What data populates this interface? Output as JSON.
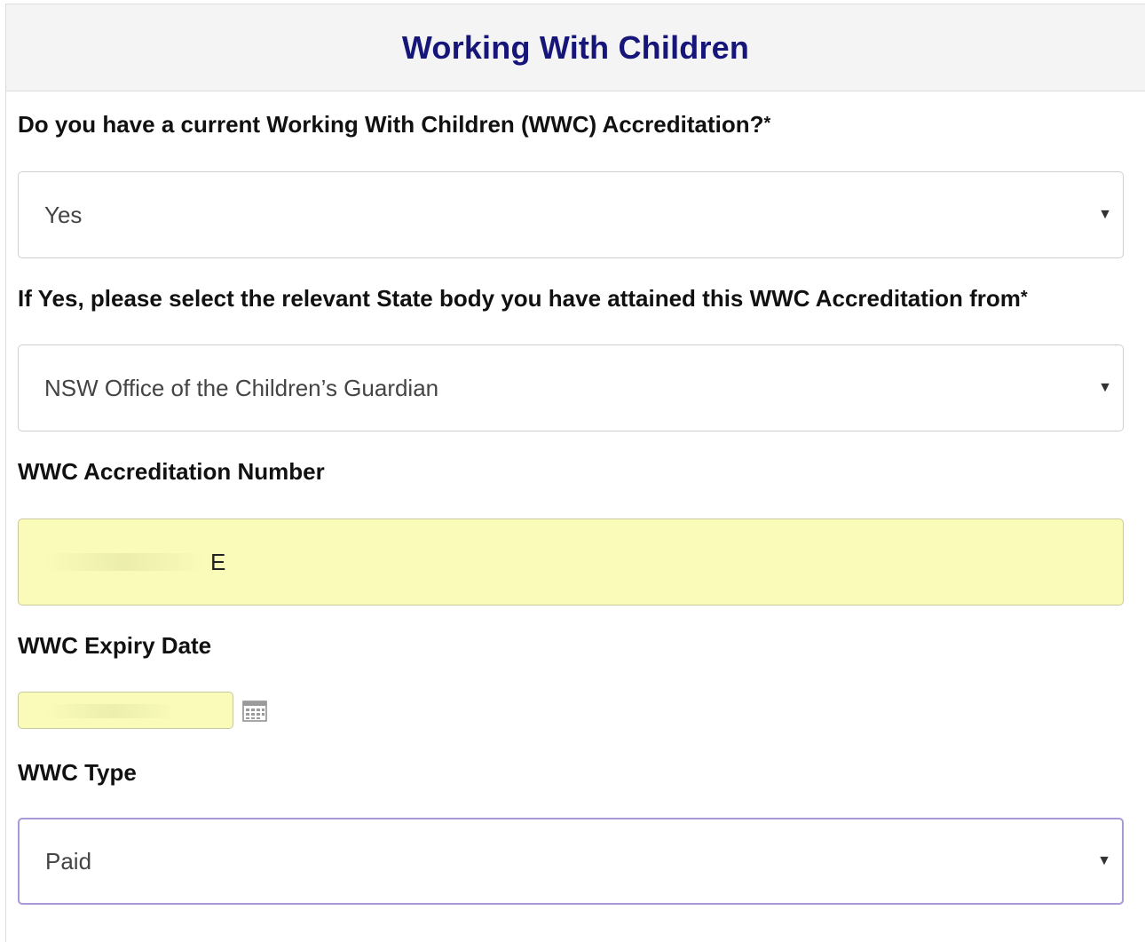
{
  "section": {
    "title": "Working With Children"
  },
  "fields": {
    "wwc_current": {
      "label": "Do you have a current Working With Children (WWC) Accreditation?",
      "required_marker": "*",
      "value": "Yes"
    },
    "state_body": {
      "label": "If Yes, please select the relevant State body you have attained this WWC Accreditation from",
      "required_marker": "*",
      "value": "NSW Office of the Children’s Guardian"
    },
    "accreditation_number": {
      "label": "WWC Accreditation Number",
      "visible_value": "E"
    },
    "expiry_date": {
      "label": "WWC Expiry Date"
    },
    "wwc_type": {
      "label": "WWC Type",
      "value": "Paid"
    }
  },
  "icons": {
    "select_caret": "▼",
    "calendar": "calendar-icon"
  },
  "colors": {
    "title": "#15157a",
    "autofill_background": "#fafbb8",
    "focus_border": "#a99ad6"
  }
}
